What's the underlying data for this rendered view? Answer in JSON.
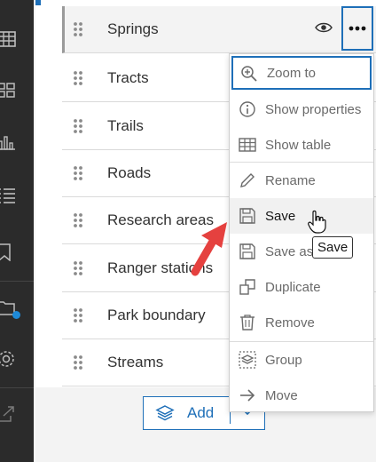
{
  "layers": [
    {
      "label": "Springs",
      "selected": true
    },
    {
      "label": "Tracts"
    },
    {
      "label": "Trails"
    },
    {
      "label": "Roads"
    },
    {
      "label": "Research areas"
    },
    {
      "label": "Ranger stations"
    },
    {
      "label": "Park boundary"
    },
    {
      "label": "Streams"
    }
  ],
  "row_icons": {
    "visibility": "eye-icon",
    "options": "more-options-icon",
    "drag": "drag-handle-icon"
  },
  "add_button": {
    "label": "Add",
    "icon": "layers-icon",
    "dropdown_icon": "chevron-down-icon"
  },
  "menu": {
    "items": [
      {
        "label": "Zoom to",
        "icon": "zoom-in-icon",
        "state": "focused"
      },
      {
        "label": "Show properties",
        "icon": "info-icon"
      },
      {
        "label": "Show table",
        "icon": "table-icon"
      },
      {
        "label": "Rename",
        "icon": "pencil-icon"
      },
      {
        "label": "Save",
        "icon": "save-icon",
        "state": "hovered"
      },
      {
        "label": "Save as",
        "icon": "save-as-icon"
      },
      {
        "label": "Duplicate",
        "icon": "duplicate-icon"
      },
      {
        "label": "Remove",
        "icon": "trash-icon"
      },
      {
        "label": "Group",
        "icon": "group-icon"
      },
      {
        "label": "Move",
        "icon": "arrow-right-icon"
      }
    ]
  },
  "tooltip": {
    "text": "Save"
  },
  "left_rail": {
    "icons": [
      "table-icon",
      "gallery-icon",
      "chart-icon",
      "list-icon",
      "bookmark-icon",
      "folder-icon",
      "settings-icon",
      "export-icon"
    ],
    "notification_badge": true
  },
  "colors": {
    "accent": "#1e6fb8",
    "rail_background": "#2b2b2b",
    "annotation_arrow": "#e5413f",
    "badge": "#1e8ad8"
  }
}
